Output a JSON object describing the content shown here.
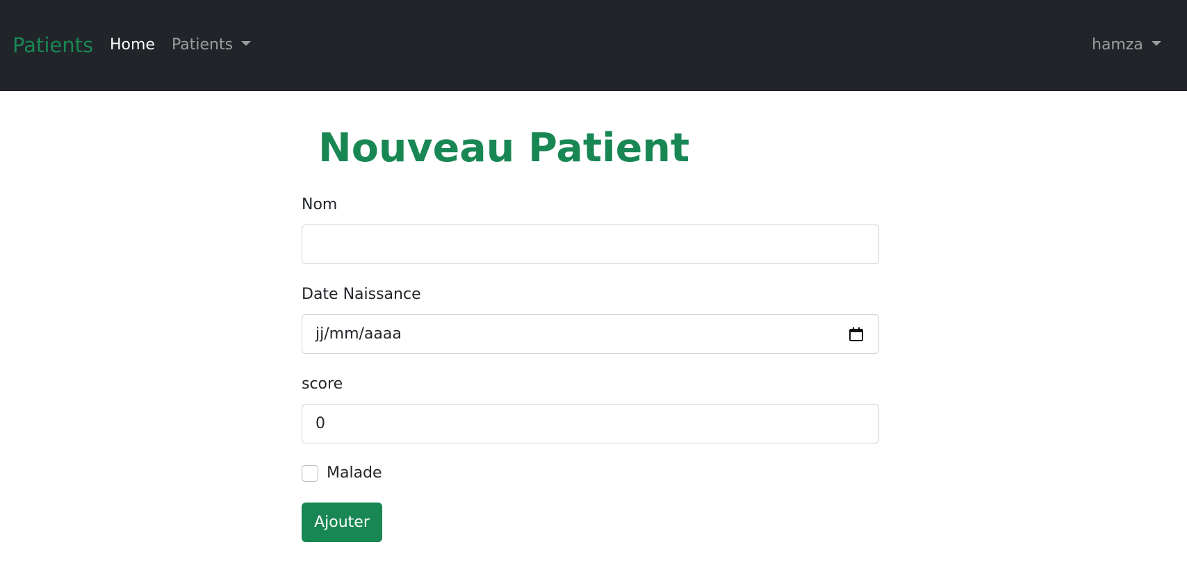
{
  "navbar": {
    "brand": "Patients",
    "links": [
      {
        "label": "Home"
      },
      {
        "label": "Patients"
      }
    ],
    "user": "hamza",
    "brand_color": "#198754",
    "background": "#212529"
  },
  "page": {
    "title": "Nouveau Patient"
  },
  "form": {
    "nom": {
      "label": "Nom",
      "value": ""
    },
    "date_naissance": {
      "label": "Date Naissance",
      "placeholder": "jj/mm/aaaa",
      "icon": "calendar-icon"
    },
    "score": {
      "label": "score",
      "value": "0"
    },
    "malade": {
      "label": "Malade",
      "checked": false
    },
    "submit_label": "Ajouter"
  }
}
